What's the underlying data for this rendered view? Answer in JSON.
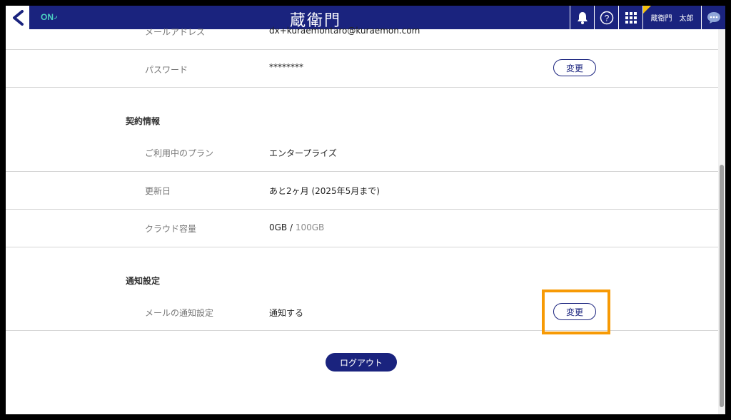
{
  "header": {
    "status": "ON",
    "logo": "蔵衛門",
    "user_company": "蔵衛門",
    "user_name": "太郎",
    "help_symbol": "?"
  },
  "account": {
    "email_label": "メールアドレス",
    "email_value": "dx+kuraemontaro@kuraemon.com",
    "password_label": "パスワード",
    "password_value": "********",
    "password_change_label": "変更"
  },
  "contract": {
    "title": "契約情報",
    "plan_label": "ご利用中のプラン",
    "plan_value": "エンタープライズ",
    "renewal_label": "更新日",
    "renewal_value": "あと2ヶ月 (2025年5月まで)",
    "storage_label": "クラウド容量",
    "storage_used": "0GB",
    "storage_sep": " / ",
    "storage_total": "100GB"
  },
  "notification": {
    "title": "通知設定",
    "mail_label": "メールの通知設定",
    "mail_value": "通知する",
    "change_label": "変更"
  },
  "logout_label": "ログアウト",
  "colors": {
    "header_bg": "#1a237e",
    "accent_online": "#4cd3c2",
    "highlight": "#f79a05"
  }
}
